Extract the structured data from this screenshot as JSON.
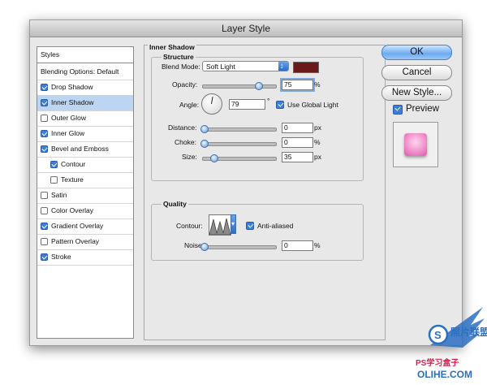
{
  "window": {
    "title": "Layer Style"
  },
  "sidebar": {
    "header": "Styles",
    "items": [
      {
        "label": "Blending Options: Default",
        "checkbox": false,
        "checked": false,
        "selected": false,
        "indent": 0
      },
      {
        "label": "Drop Shadow",
        "checkbox": true,
        "checked": true,
        "selected": false,
        "indent": 0
      },
      {
        "label": "Inner Shadow",
        "checkbox": true,
        "checked": true,
        "selected": true,
        "indent": 0
      },
      {
        "label": "Outer Glow",
        "checkbox": true,
        "checked": false,
        "selected": false,
        "indent": 0
      },
      {
        "label": "Inner Glow",
        "checkbox": true,
        "checked": true,
        "selected": false,
        "indent": 0
      },
      {
        "label": "Bevel and Emboss",
        "checkbox": true,
        "checked": true,
        "selected": false,
        "indent": 0
      },
      {
        "label": "Contour",
        "checkbox": true,
        "checked": true,
        "selected": false,
        "indent": 1
      },
      {
        "label": "Texture",
        "checkbox": true,
        "checked": false,
        "selected": false,
        "indent": 1
      },
      {
        "label": "Satin",
        "checkbox": true,
        "checked": false,
        "selected": false,
        "indent": 0
      },
      {
        "label": "Color Overlay",
        "checkbox": true,
        "checked": false,
        "selected": false,
        "indent": 0
      },
      {
        "label": "Gradient Overlay",
        "checkbox": true,
        "checked": true,
        "selected": false,
        "indent": 0
      },
      {
        "label": "Pattern Overlay",
        "checkbox": true,
        "checked": false,
        "selected": false,
        "indent": 0
      },
      {
        "label": "Stroke",
        "checkbox": true,
        "checked": true,
        "selected": false,
        "indent": 0
      }
    ]
  },
  "panel": {
    "title": "Inner Shadow",
    "structure": {
      "title": "Structure",
      "blend_mode_label": "Blend Mode:",
      "blend_mode_value": "Soft Light",
      "shadow_color": "#6b1a1a",
      "opacity_label": "Opacity:",
      "opacity_value": "75",
      "opacity_unit": "%",
      "opacity_fraction": 0.75,
      "angle_label": "Angle:",
      "angle_value": "79",
      "angle_unit": "°",
      "global_light_label": "Use Global Light",
      "global_light_checked": true,
      "distance_label": "Distance:",
      "distance_value": "0",
      "distance_unit": "px",
      "choke_label": "Choke:",
      "choke_value": "0",
      "choke_unit": "%",
      "size_label": "Size:",
      "size_value": "35",
      "size_unit": "px",
      "size_fraction": 0.14
    },
    "quality": {
      "title": "Quality",
      "contour_label": "Contour:",
      "anti_aliased_label": "Anti-aliased",
      "anti_aliased_checked": true,
      "noise_label": "Noise:",
      "noise_value": "0",
      "noise_unit": "%"
    }
  },
  "buttons": {
    "ok": "OK",
    "cancel": "Cancel",
    "new_style": "New Style...",
    "preview_label": "Preview",
    "preview_checked": true
  },
  "watermark": {
    "brand": "PS学习盒子",
    "cn_label": "照片联盟",
    "site": "OLIHE.COM"
  },
  "colors": {
    "accent": "#3c7fd6",
    "selection": "#bcd5f2",
    "preview_pink": "#f08ac8"
  }
}
